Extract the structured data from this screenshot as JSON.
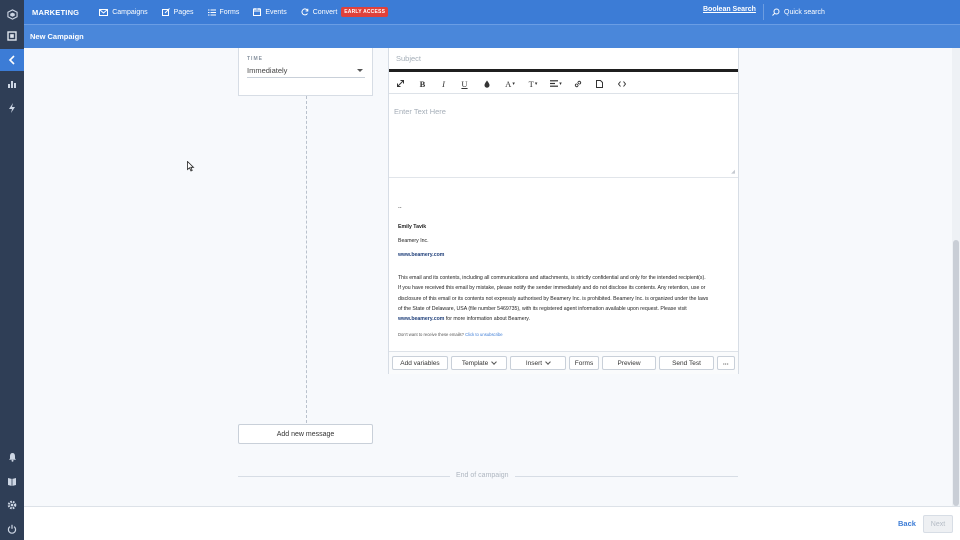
{
  "topnav": {
    "brand": "MARKETING",
    "items": [
      {
        "label": "Campaigns",
        "icon": "envelope-icon"
      },
      {
        "label": "Pages",
        "icon": "edit-page-icon"
      },
      {
        "label": "Forms",
        "icon": "list-icon"
      },
      {
        "label": "Events",
        "icon": "calendar-icon"
      },
      {
        "label": "Convert",
        "icon": "refresh-icon"
      }
    ],
    "badge": "EARLY ACCESS",
    "boolean_search": "Boolean Search",
    "quick_search": "Quick search"
  },
  "page": {
    "title": "New Campaign"
  },
  "time": {
    "label": "TIME",
    "value": "Immediately"
  },
  "email": {
    "subject_placeholder": "Subject",
    "body_placeholder": "Enter Text Here",
    "toolbar": {
      "bold": "B",
      "italic": "I",
      "underline": "U",
      "font": "A",
      "size": "T"
    },
    "signature": {
      "dash": "--",
      "name": "Emily Tavik",
      "company": "Beamery Inc.",
      "website": "www.beamery.com",
      "legal_1": "This email and its contents, including all communications and attachments, is strictly confidential and only for the intended recipient(s).",
      "legal_2": "If you have received this email by mistake, please notify the sender immediately and do not disclose its contents. Any retention, use or",
      "legal_3": "disclosure of this email or its contents not expressly authorised by Beamery Inc. is prohibited. Beamery Inc. is organized under the laws",
      "legal_4": "of the State of Delaware, USA (file number 5469735), with its registered agent information available upon request. Please visit",
      "legal_link": "www.beamery.com",
      "legal_5": " for more information about Beamery.",
      "unsub_text": "Don't want to receive these emails? ",
      "unsub_link": "Click to unsubscribe"
    },
    "buttons": {
      "add_variables": "Add variables",
      "template": "Template",
      "insert": "Insert",
      "forms": "Forms",
      "preview": "Preview",
      "send_test": "Send Test",
      "more": "•••"
    }
  },
  "add_message": "Add new message",
  "end_of_campaign": "End of campaign",
  "footer": {
    "back": "Back",
    "next": "Next"
  },
  "colors": {
    "primary": "#3c7cd6",
    "rail": "#2f3e56",
    "badge": "#e0413a"
  }
}
